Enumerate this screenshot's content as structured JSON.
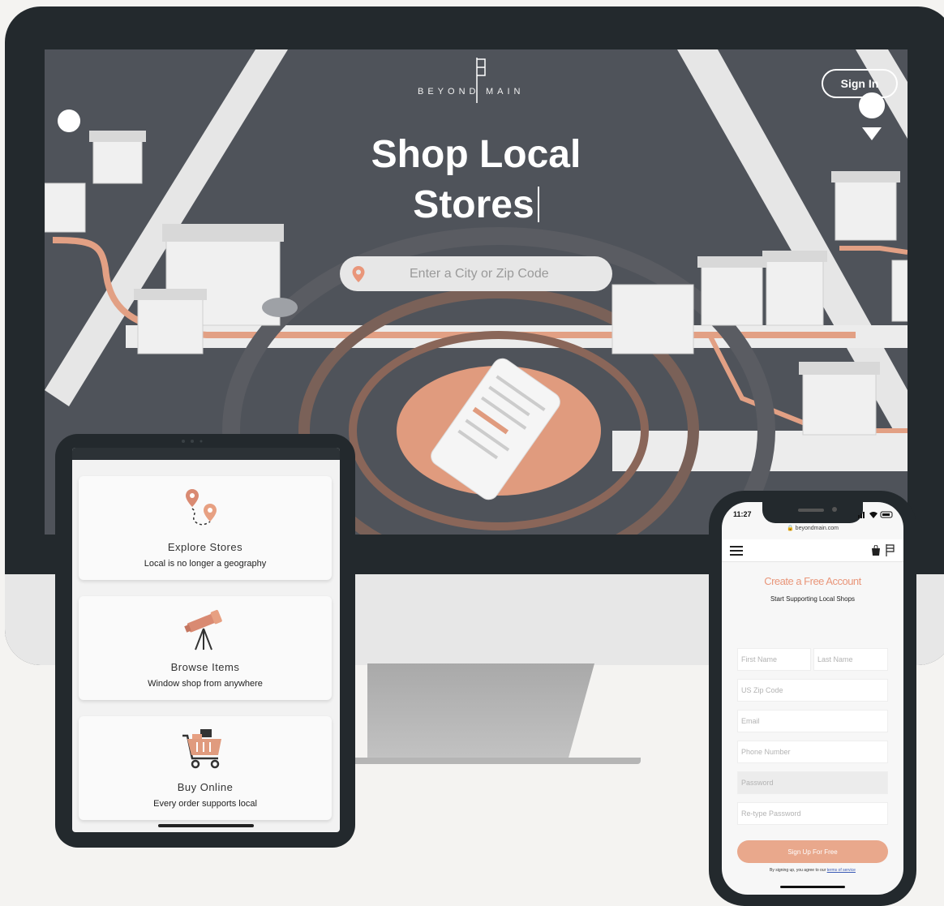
{
  "desktop": {
    "logo_left": "BEYOND",
    "logo_right": "MAIN",
    "sign_in": "Sign In",
    "hero_line1": "Shop Local",
    "hero_line2": "Stores",
    "search_placeholder": "Enter a City or Zip Code"
  },
  "tablet": {
    "cards": [
      {
        "title": "Explore Stores",
        "subtitle": "Local is no longer a geography",
        "icon": "map-pins-icon"
      },
      {
        "title": "Browse Items",
        "subtitle": "Window shop from anywhere",
        "icon": "telescope-icon"
      },
      {
        "title": "Buy Online",
        "subtitle": "Every order supports local",
        "icon": "shopping-cart-icon"
      }
    ]
  },
  "phone": {
    "time": "11:27",
    "url": "beyondmain.com",
    "title": "Create a Free Account",
    "subtitle": "Start Supporting Local Shops",
    "fields": {
      "first_name": "First Name",
      "last_name": "Last Name",
      "zip": "US Zip Code",
      "email": "Email",
      "phone": "Phone Number",
      "password": "Password",
      "retype": "Re-type Password"
    },
    "submit": "Sign Up For Free",
    "terms_prefix": "By signing up, you agree to our",
    "terms_link": "terms of service"
  },
  "colors": {
    "accent": "#e9967a",
    "bezel": "#23292d",
    "hero_bg": "#4f535a"
  }
}
